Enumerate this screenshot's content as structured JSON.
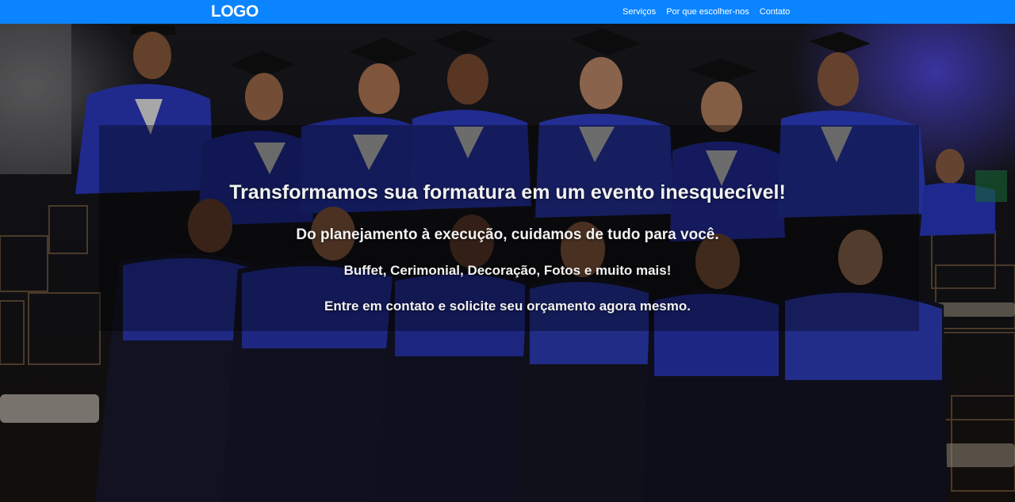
{
  "navbar": {
    "logo": "LOGO",
    "links": [
      {
        "label": "Serviços"
      },
      {
        "label": "Por que escolher-nos"
      },
      {
        "label": "Contato"
      }
    ],
    "background": "#0a84ff"
  },
  "hero": {
    "headline": "Transformamos sua formatura em um evento inesquecível!",
    "subtitle_1": "Do planejamento à execução, cuidamos de tudo para você.",
    "subtitle_2": "Buffet, Cerimonial, Decoração, Fotos e muito mais!",
    "subtitle_3": "Entre em contato e solicite seu orçamento agora mesmo."
  }
}
